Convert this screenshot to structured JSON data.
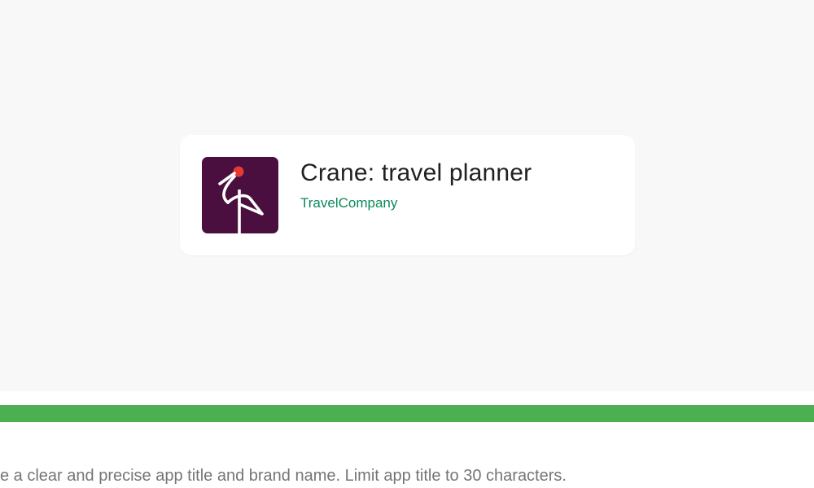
{
  "app_card": {
    "title": "Crane: travel planner",
    "brand": "TravelCompany",
    "icon": "crane-logo-icon"
  },
  "guideline": {
    "status_color": "#4caf50",
    "mark": ".",
    "text": "e a clear and precise app title and brand name. Limit app title to 30 characters."
  },
  "colors": {
    "icon_background": "#4a0e3f",
    "crane_head": "#e53935",
    "brand_text": "#0c8a5a"
  }
}
